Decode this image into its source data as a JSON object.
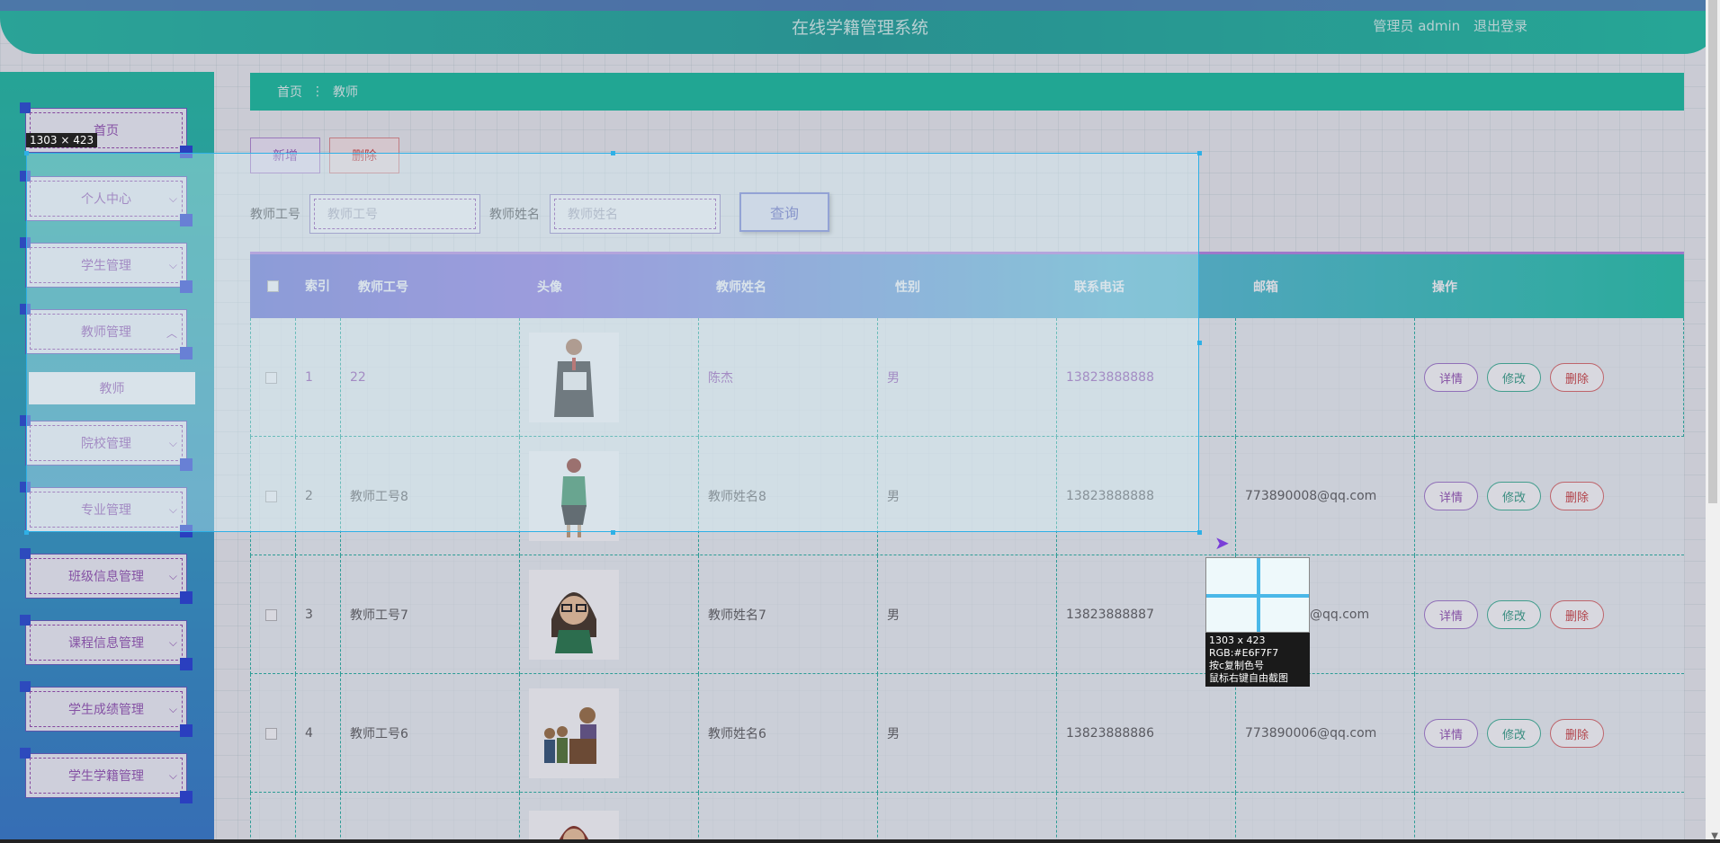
{
  "header": {
    "title": "在线学籍管理系统",
    "user": "管理员 admin",
    "logout": "退出登录"
  },
  "sidebar": {
    "items": [
      {
        "label": "首页"
      },
      {
        "label": "个人中心"
      },
      {
        "label": "学生管理"
      },
      {
        "label": "教师管理"
      },
      {
        "label": "教师"
      },
      {
        "label": "院校管理"
      },
      {
        "label": "专业管理"
      },
      {
        "label": "班级信息管理"
      },
      {
        "label": "课程信息管理"
      },
      {
        "label": "学生成绩管理"
      },
      {
        "label": "学生学籍管理"
      }
    ]
  },
  "breadcrumb": {
    "home": "首页",
    "sep": "⋮",
    "current": "教师"
  },
  "toolbar": {
    "add": "新增",
    "delete": "删除"
  },
  "search": {
    "id_label": "教师工号",
    "id_placeholder": "教师工号",
    "name_label": "教师姓名",
    "name_placeholder": "教师姓名",
    "query": "查询"
  },
  "table": {
    "headers": [
      "索引",
      "教师工号",
      "头像",
      "教师姓名",
      "性别",
      "联系电话",
      "邮箱",
      "操作"
    ],
    "rows": [
      {
        "index": "1",
        "id": "22",
        "name": "陈杰",
        "gender": "男",
        "phone": "13823888888",
        "email": ""
      },
      {
        "index": "2",
        "id": "教师工号8",
        "name": "教师姓名8",
        "gender": "男",
        "phone": "13823888888",
        "email": "773890008@qq.com"
      },
      {
        "index": "3",
        "id": "教师工号7",
        "name": "教师姓名7",
        "gender": "男",
        "phone": "13823888887",
        "email": "@qq.com"
      },
      {
        "index": "4",
        "id": "教师工号6",
        "name": "教师姓名6",
        "gender": "男",
        "phone": "13823888886",
        "email": "773890006@qq.com"
      }
    ],
    "ops": {
      "detail": "详情",
      "edit": "修改",
      "delete": "删除"
    }
  },
  "screenshot_tool": {
    "size_label": "1303 × 423",
    "info_size": "1303 x 423",
    "info_rgb": "RGB:#E6F7F7",
    "info_copy": "按c复制色号",
    "info_hint": "鼠标右键自由截图"
  },
  "colors": {
    "primary": "#20c2a3",
    "accent": "#9a5bb8",
    "danger": "#d14a4a"
  }
}
